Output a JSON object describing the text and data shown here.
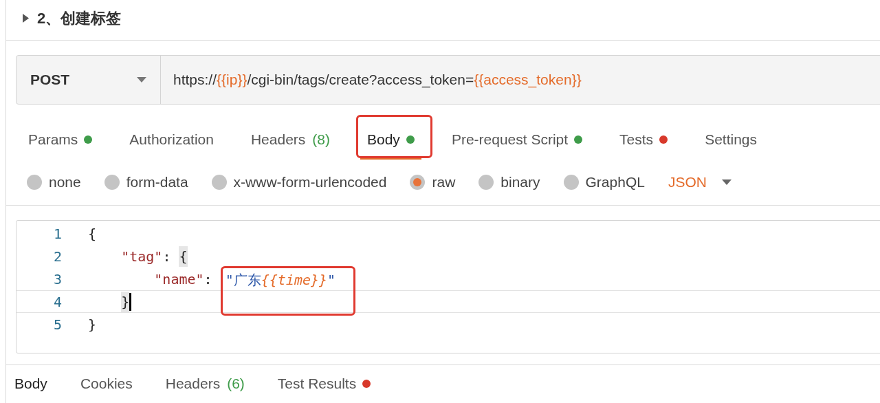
{
  "section": {
    "title": "2、创建标签",
    "expanded": false
  },
  "request": {
    "method": "POST",
    "url": [
      {
        "kind": "text",
        "text": "https://"
      },
      {
        "kind": "variable",
        "text": "{{ip}}"
      },
      {
        "kind": "text",
        "text": "/cgi-bin/tags/create?access_token="
      },
      {
        "kind": "variable",
        "text": "{{access_token}}"
      }
    ]
  },
  "tabs": [
    {
      "label": "Params",
      "color": "#3f9c4a",
      "selected": false,
      "annotated": false
    },
    {
      "label": "Authorization",
      "selected": false,
      "annotated": false
    },
    {
      "label": "Headers",
      "count": "(8)",
      "selected": false,
      "annotated": false
    },
    {
      "label": "Body",
      "color": "#3f9c4a",
      "selected": true,
      "annotated": true
    },
    {
      "label": "Pre-request Script",
      "color": "#3f9c4a",
      "selected": false,
      "annotated": false
    },
    {
      "label": "Tests",
      "color": "#d8392b",
      "selected": false,
      "annotated": false
    },
    {
      "label": "Settings",
      "selected": false,
      "annotated": false
    }
  ],
  "body_types": [
    {
      "label": "none",
      "selected": false
    },
    {
      "label": "form-data",
      "selected": false
    },
    {
      "label": "x-www-form-urlencoded",
      "selected": false
    },
    {
      "label": "raw",
      "selected": true
    },
    {
      "label": "binary",
      "selected": false
    },
    {
      "label": "GraphQL",
      "selected": false
    }
  ],
  "format": {
    "label": "JSON"
  },
  "editor": {
    "lines": [
      {
        "number": "1",
        "current": false,
        "tokens": [
          {
            "kind": "punct",
            "text": "{"
          }
        ]
      },
      {
        "number": "2",
        "current": false,
        "tokens": [
          {
            "kind": "key",
            "text": "    \"tag\""
          },
          {
            "kind": "punct",
            "text": ": "
          },
          {
            "kind": "punct",
            "text": "{",
            "matched": true
          }
        ]
      },
      {
        "number": "3",
        "current": false,
        "tokens": [
          {
            "kind": "key",
            "text": "        \"name\""
          },
          {
            "kind": "punct",
            "text": ": "
          },
          {
            "kind": "string",
            "text": "\"广东",
            "annotated": true
          },
          {
            "kind": "variable",
            "text": "{{time}}",
            "annotated": true
          },
          {
            "kind": "string",
            "text": "\"",
            "annotated": true
          }
        ]
      },
      {
        "number": "4",
        "current": true,
        "tokens": [
          {
            "kind": "punct",
            "text": "    }",
            "matched": true
          }
        ]
      },
      {
        "number": "5",
        "current": false,
        "tokens": [
          {
            "kind": "punct",
            "text": "}"
          }
        ]
      }
    ]
  },
  "response_tabs": [
    {
      "label": "Body",
      "selected": true
    },
    {
      "label": "Cookies",
      "selected": false
    },
    {
      "label": "Headers",
      "count": "(6)",
      "selected": false
    },
    {
      "label": "Test Results",
      "color": "#d8392b",
      "selected": false
    }
  ]
}
